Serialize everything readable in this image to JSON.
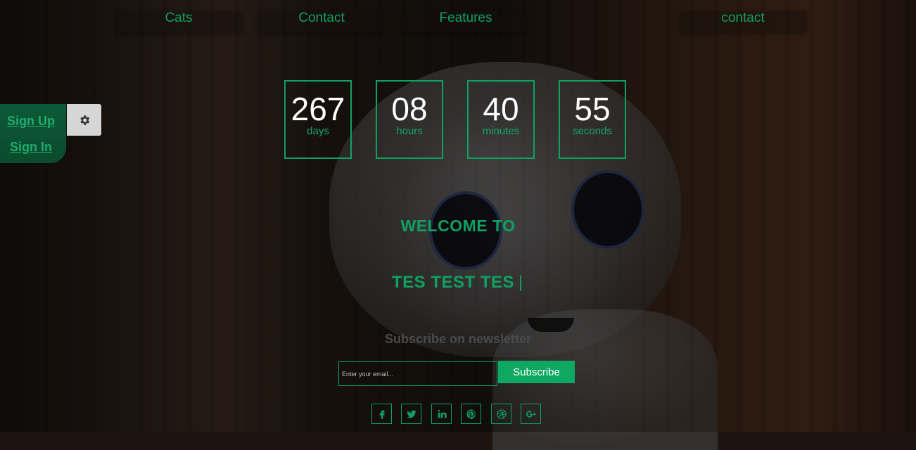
{
  "nav": {
    "items": [
      {
        "label": "Cats"
      },
      {
        "label": "Contact"
      },
      {
        "label": "Features"
      },
      {
        "label": ""
      },
      {
        "label": "contact"
      }
    ]
  },
  "auth": {
    "signup_label": "Sign Up",
    "signin_label": "Sign In",
    "settings_icon": "gear-icon"
  },
  "countdown": [
    {
      "value": "267",
      "unit": "days"
    },
    {
      "value": "08",
      "unit": "hours"
    },
    {
      "value": "40",
      "unit": "minutes"
    },
    {
      "value": "55",
      "unit": "seconds"
    }
  ],
  "hero": {
    "welcome": "WELCOME TO",
    "typed_text": "TES TEST TES",
    "typed_cursor": "|"
  },
  "newsletter": {
    "title": "Subscribe on newsletter",
    "email_placeholder": "Enter your email...",
    "email_value": "",
    "button_label": "Subscribe"
  },
  "social": [
    {
      "icon": "facebook-icon"
    },
    {
      "icon": "twitter-icon"
    },
    {
      "icon": "linkedin-icon"
    },
    {
      "icon": "pinterest-icon"
    },
    {
      "icon": "dribbble-icon"
    },
    {
      "icon": "google-plus-icon"
    }
  ],
  "colors": {
    "accent": "#0fa062",
    "button": "#0ea863",
    "auth_panel": "#0c5a38"
  }
}
